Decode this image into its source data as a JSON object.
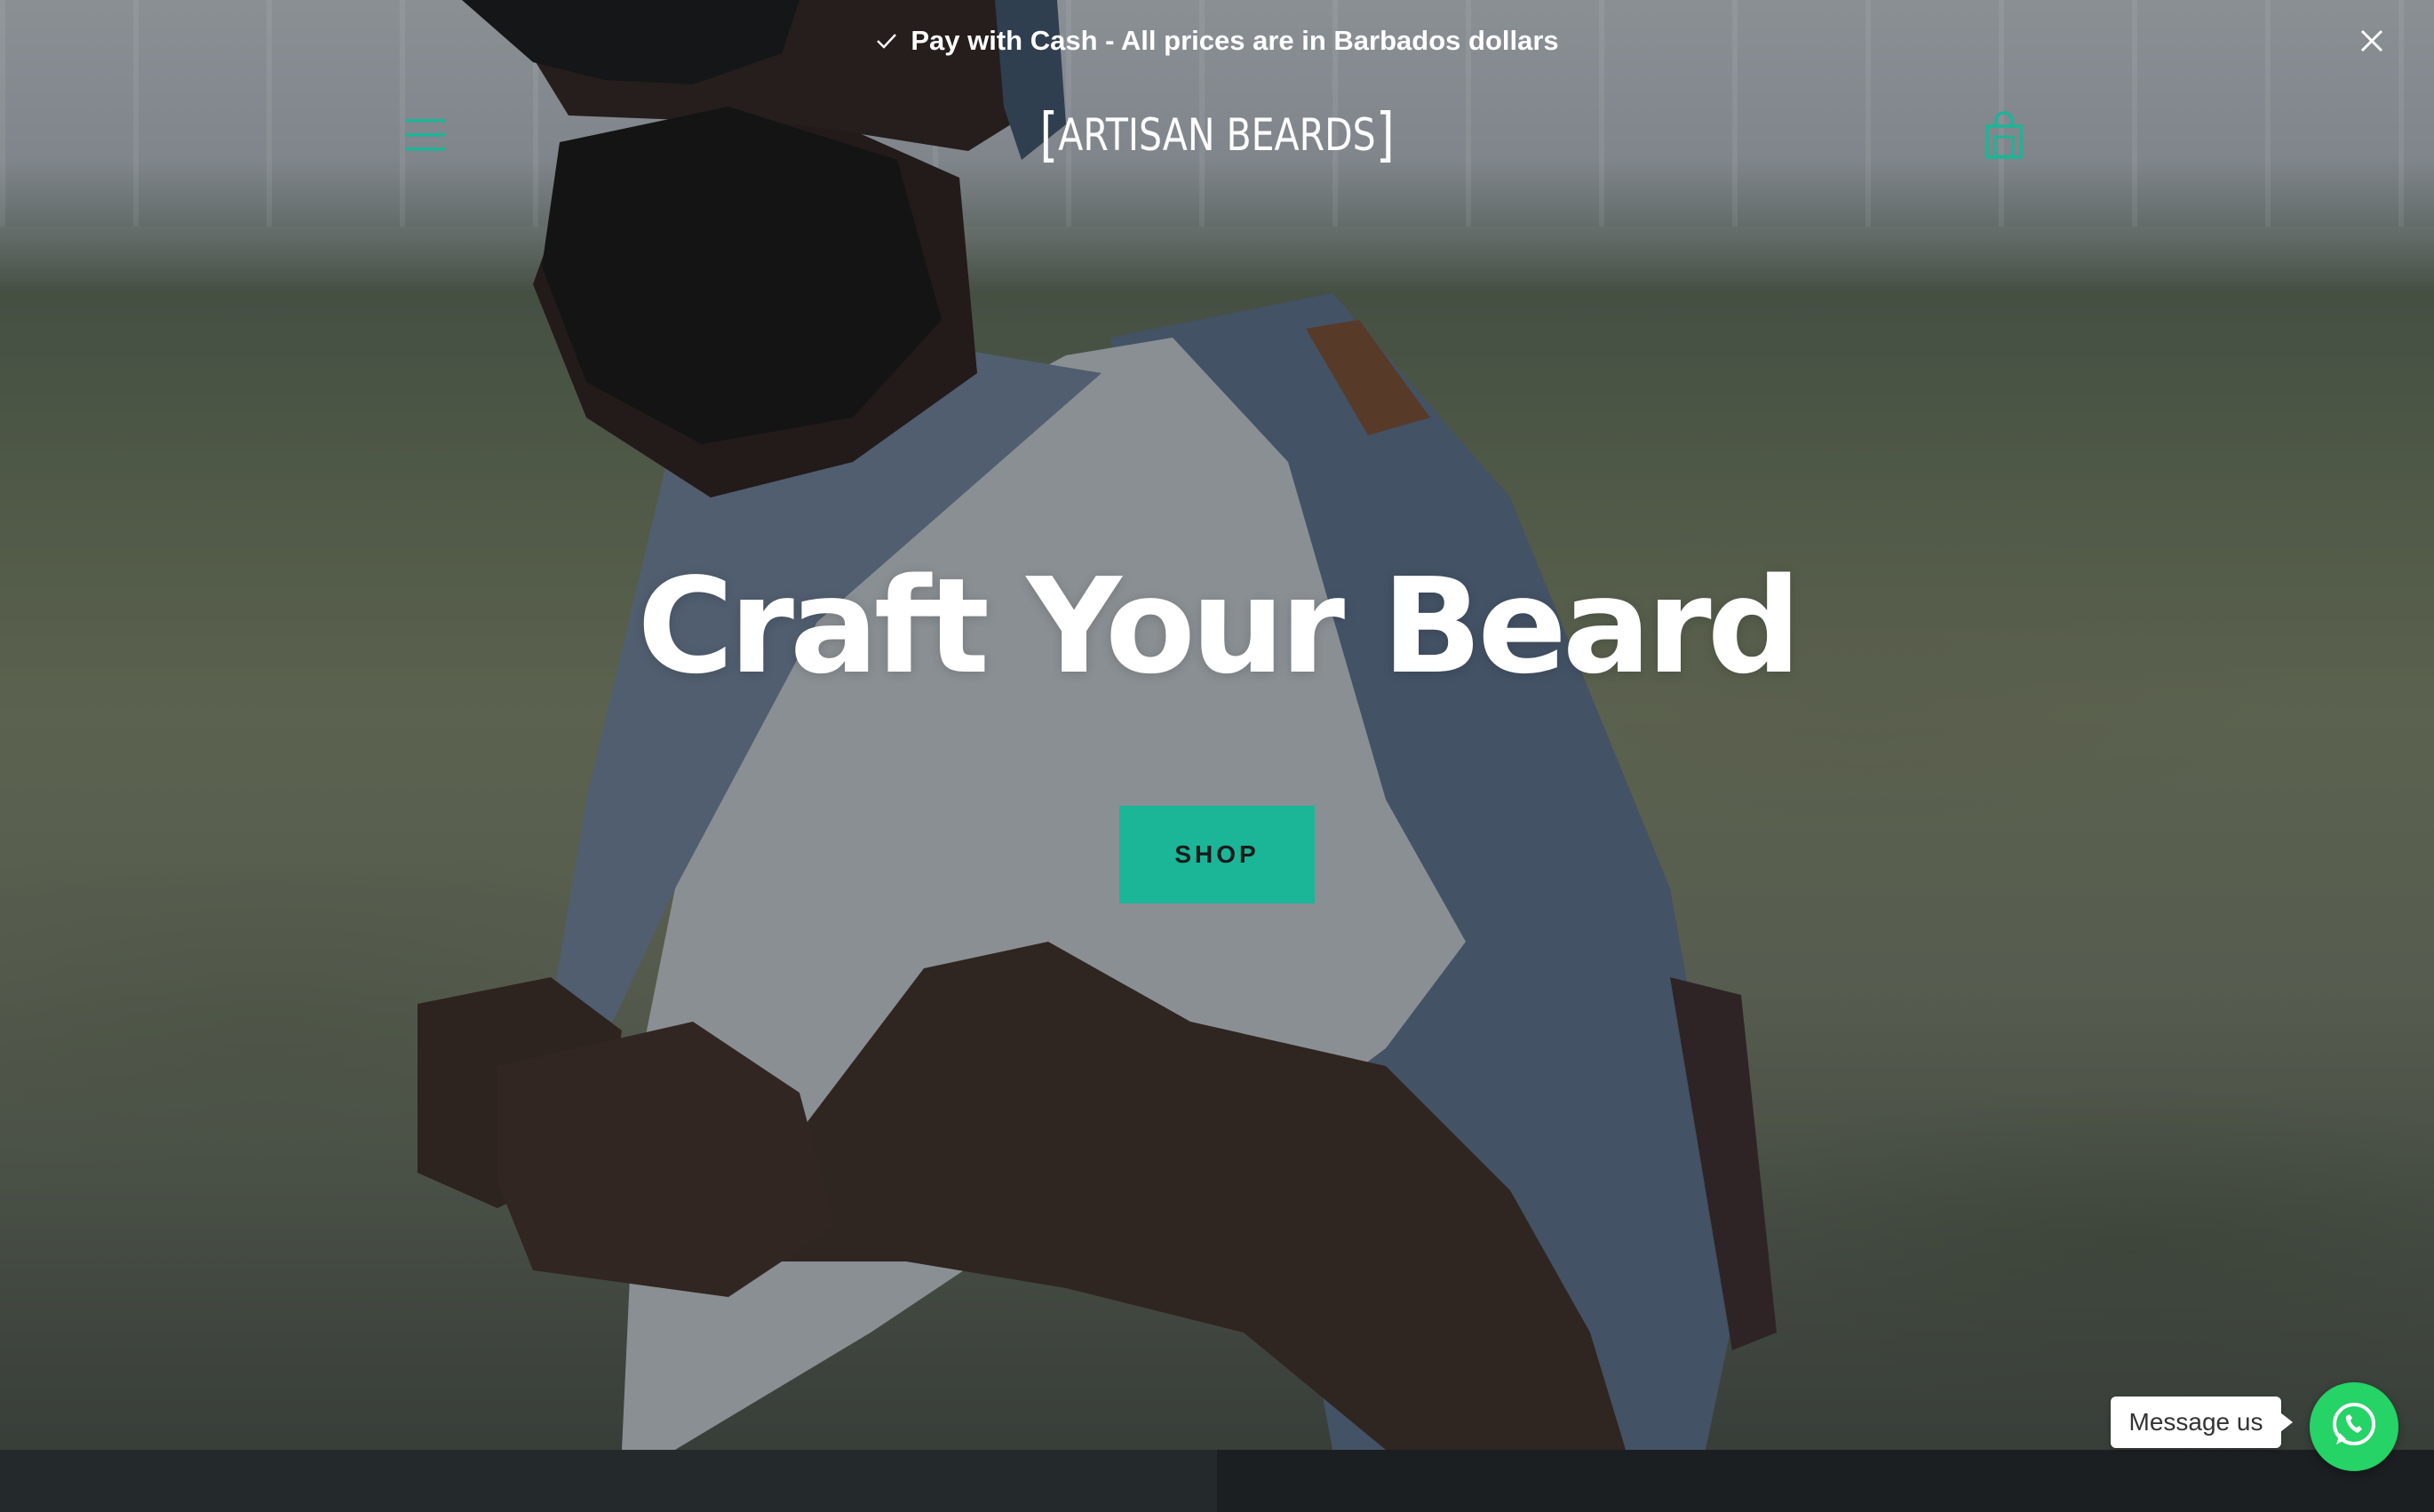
{
  "announcement": {
    "text": "Pay with Cash - All prices are in Barbados dollars",
    "icon": "check-icon",
    "close_icon": "close-icon"
  },
  "header": {
    "menu_icon": "hamburger-menu-icon",
    "logo_text": "ARTISAN BEARDS",
    "cart_icon": "shopping-bag-icon"
  },
  "hero": {
    "headline": "Craft Your Beard",
    "cta_label": "SHOP",
    "image": "man with beard, sunglasses and backpack"
  },
  "chat_widget": {
    "label": "Message us",
    "icon": "whatsapp-icon"
  },
  "colors": {
    "accent": "#1bb597",
    "whatsapp": "#25d366",
    "text": "#ffffff",
    "footer_left": "#24292b",
    "footer_right": "#1b1f21"
  }
}
